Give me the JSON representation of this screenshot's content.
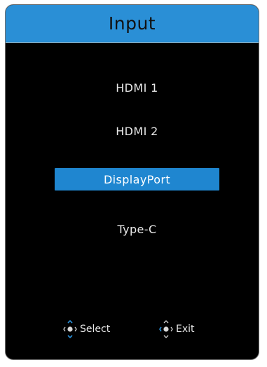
{
  "osd": {
    "title": "Input",
    "items": [
      {
        "label": "HDMI 1",
        "selected": false
      },
      {
        "label": "HDMI 2",
        "selected": false
      },
      {
        "label": "DisplayPort",
        "selected": true
      },
      {
        "label": "Type-C",
        "selected": false
      }
    ],
    "hints": {
      "select": {
        "icon": "joystick-icon",
        "label": "Select"
      },
      "exit": {
        "icon": "joystick-icon",
        "label": "Exit"
      }
    }
  },
  "colors": {
    "header": "#2a8fd6",
    "selected": "#1f86d0",
    "background": "#000000",
    "text": "#e8e8e8"
  }
}
